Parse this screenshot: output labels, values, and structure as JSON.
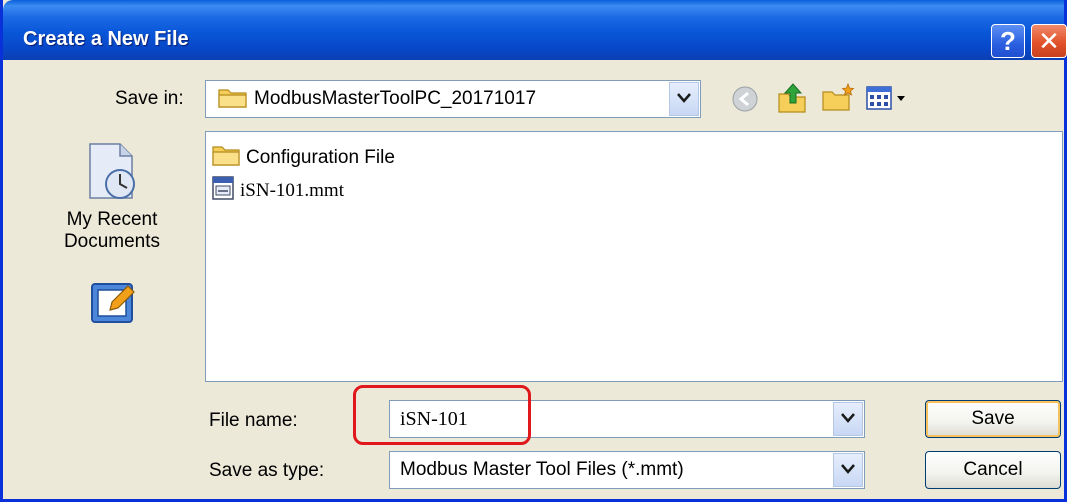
{
  "window": {
    "title": "Create a New File"
  },
  "titlebar": {
    "help_label": "?",
    "close_label": "✕"
  },
  "save_in": {
    "label": "Save in:",
    "value": "ModbusMasterToolPC_20171017"
  },
  "places": [
    {
      "label_line1": "My Recent",
      "label_line2": "Documents",
      "icon": "recent-documents-icon"
    },
    {
      "label_line1": "",
      "label_line2": "",
      "icon": "desktop-icon"
    }
  ],
  "files": [
    {
      "name": "Configuration File",
      "type": "folder"
    },
    {
      "name": "iSN-101.mmt",
      "type": "mmt-file"
    }
  ],
  "file_name": {
    "label": "File name:",
    "value": "iSN-101"
  },
  "save_as_type": {
    "label": "Save as type:",
    "value": "Modbus Master Tool Files (*.mmt)"
  },
  "buttons": {
    "save": "Save",
    "cancel": "Cancel"
  },
  "colors": {
    "title_bar": "#0856d8",
    "highlight": "#e0171b",
    "dialog_bg": "#ece9d8"
  }
}
